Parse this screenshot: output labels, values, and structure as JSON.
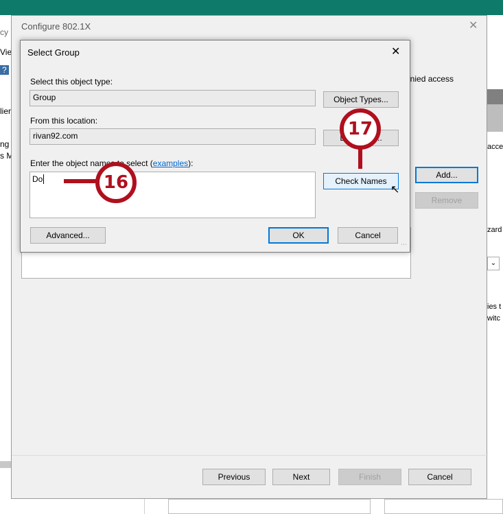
{
  "background": {
    "left_fragments": [
      "cy",
      "Vie",
      "?",
      "lier",
      "ng",
      "s M"
    ],
    "right_text": "r denied access",
    "right_fragments": [
      "acce",
      "zard",
      "ies t",
      "witc"
    ]
  },
  "configure": {
    "title": "Configure 802.1X",
    "add_label": "Add...",
    "remove_label": "Remove",
    "previous_label": "Previous",
    "next_label": "Next",
    "finish_label": "Finish",
    "cancel_label": "Cancel"
  },
  "select_group": {
    "title": "Select Group",
    "object_type_label": "Select this object type:",
    "object_type_value": "Group",
    "object_types_button": "Object Types...",
    "location_label": "From this location:",
    "location_value": "rivan92.com",
    "locations_button": "Locations...",
    "enter_label_prefix": "Enter the object names to select (",
    "examples_link": "examples",
    "enter_label_suffix": "):",
    "names_value": "Do",
    "check_names_button": "Check Names",
    "advanced_button": "Advanced...",
    "ok_button": "OK",
    "cancel_button": "Cancel"
  },
  "callouts": {
    "step16": "16",
    "step17": "17"
  },
  "colors": {
    "accent_bar": "#0e7a6a",
    "callout": "#b0101e",
    "primary_border": "#0078d7"
  }
}
